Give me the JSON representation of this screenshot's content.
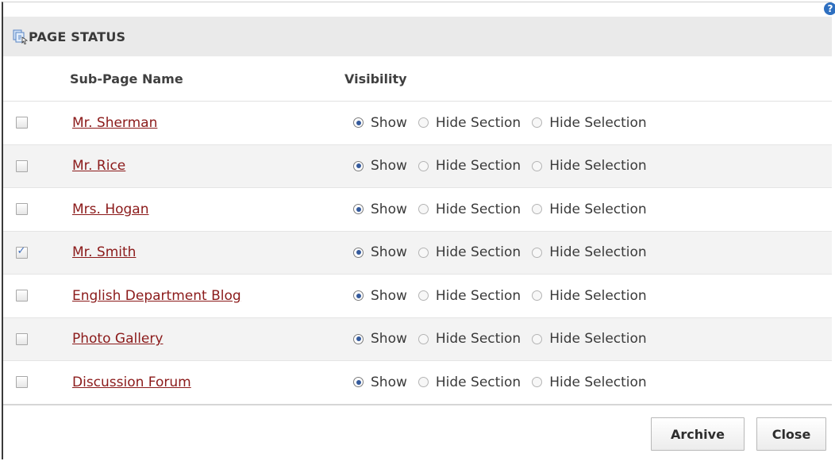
{
  "dialog": {
    "title": "PAGE STATUS",
    "help_icon": "?"
  },
  "table": {
    "headers": {
      "name": "Sub-Page Name",
      "visibility": "Visibility"
    },
    "option_labels": {
      "show": "Show",
      "hide_section": "Hide Section",
      "hide_selection": "Hide Selection"
    },
    "rows": [
      {
        "name": "Mr. Sherman",
        "checked": false,
        "visibility": "Show"
      },
      {
        "name": "Mr. Rice",
        "checked": false,
        "visibility": "Show"
      },
      {
        "name": "Mrs. Hogan",
        "checked": false,
        "visibility": "Show"
      },
      {
        "name": "Mr. Smith",
        "checked": true,
        "visibility": "Show"
      },
      {
        "name": "English Department Blog",
        "checked": false,
        "visibility": "Show"
      },
      {
        "name": "Photo Gallery",
        "checked": false,
        "visibility": "Show"
      },
      {
        "name": "Discussion Forum",
        "checked": false,
        "visibility": "Show"
      }
    ]
  },
  "buttons": {
    "archive": "Archive",
    "close": "Close"
  },
  "colors": {
    "link": "#8b1a1a",
    "titlebar_bg": "#eaeaea",
    "alt_row_bg": "#f3f3f3",
    "radio_selected": "#345a9c"
  }
}
